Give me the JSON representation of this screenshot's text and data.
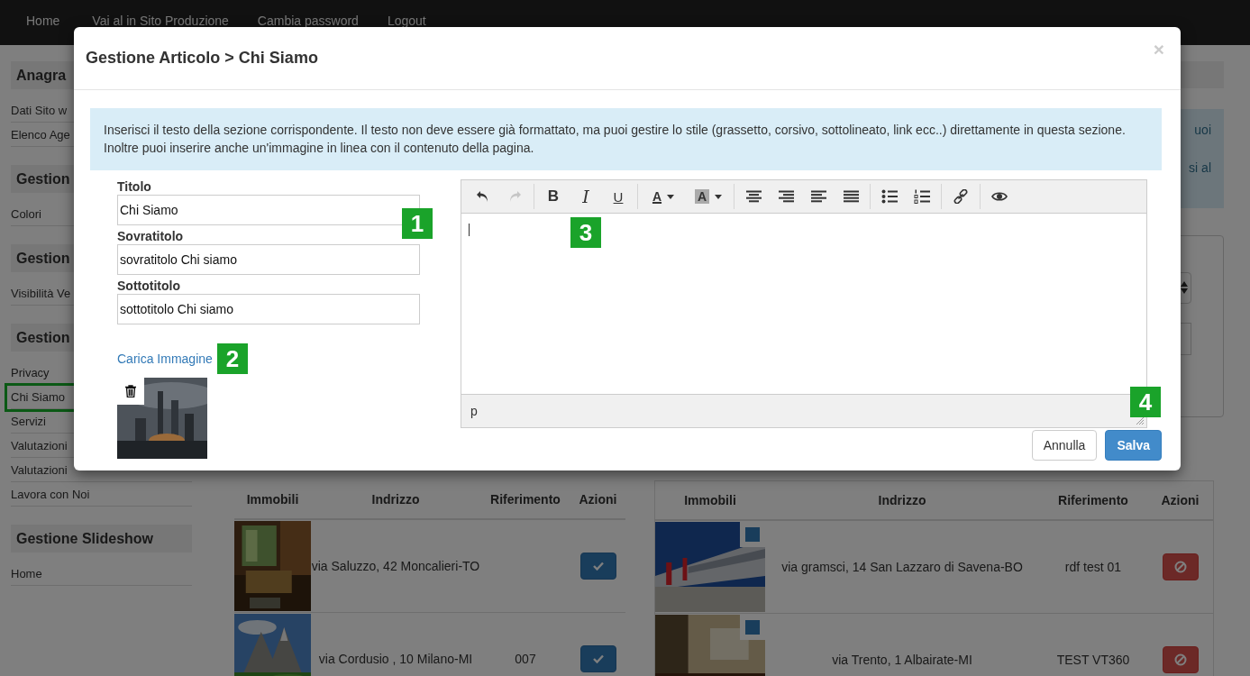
{
  "top_nav": {
    "links": [
      "Home",
      "Vai al in Sito Produzione",
      "Cambia password",
      "Logout"
    ]
  },
  "sidebar": {
    "sections": [
      {
        "heading": "Anagra",
        "items": [
          {
            "label": "Dati Sito w",
            "highlighted": false
          },
          {
            "label": "Elenco Age",
            "highlighted": false
          }
        ]
      },
      {
        "heading": "Gestion",
        "items": [
          {
            "label": "Colori",
            "highlighted": false
          }
        ]
      },
      {
        "heading": "Gestion",
        "items": [
          {
            "label": "Visibilità Ve",
            "highlighted": false
          }
        ]
      },
      {
        "heading": "Gestion",
        "items": [
          {
            "label": "Privacy",
            "highlighted": false
          },
          {
            "label": "Chi Siamo",
            "highlighted": true
          },
          {
            "label": "Servizi",
            "highlighted": false
          },
          {
            "label": "Valutazioni",
            "highlighted": false
          },
          {
            "label": "Valutazioni",
            "highlighted": false
          },
          {
            "label": "Lavora con Noi",
            "highlighted": false
          }
        ]
      },
      {
        "heading": "Gestione Slideshow",
        "items": [
          {
            "label": "Home",
            "highlighted": false
          }
        ]
      }
    ]
  },
  "main": {
    "info_fragments": [
      "uoi",
      "si al"
    ]
  },
  "tables": [
    {
      "bordered": false,
      "photo_checkbox": false,
      "columns": [
        "Immobili",
        "Indrizzo",
        "Riferimento",
        "Azioni"
      ],
      "rows": [
        {
          "address": "via Saluzzo, 42 Moncalieri-TO",
          "reference": "",
          "kind": "confirm"
        },
        {
          "address": "via Cordusio , 10 Milano-MI",
          "reference": "007",
          "kind": "confirm"
        }
      ]
    },
    {
      "bordered": true,
      "photo_checkbox": true,
      "columns": [
        "Immobili",
        "Indrizzo",
        "Riferimento",
        "Azioni"
      ],
      "rows": [
        {
          "address": "via gramsci, 14 San Lazzaro di Savena-BO",
          "reference": "rdf test 01",
          "kind": "block"
        },
        {
          "address": "via Trento, 1 Albairate-MI",
          "reference": "TEST VT360",
          "kind": "block"
        }
      ]
    }
  ],
  "modal": {
    "title": "Gestione Articolo > Chi Siamo",
    "close": "×",
    "info": "Inserisci il testo della sezione corrispondente. Il testo non deve essere già formattato, ma puoi gestire lo stile (grassetto, corsivo, sottolineato, link ecc..) direttamente in questa sezione. Inoltre puoi inserire anche un'immagine in linea con il contenuto della pagina.",
    "fields": [
      {
        "label": "Titolo",
        "value": "Chi Siamo",
        "badge": "1"
      },
      {
        "label": "Sovratitolo",
        "value": "sovratitolo Chi siamo"
      },
      {
        "label": "Sottotitolo",
        "value": "sottotitolo Chi siamo"
      }
    ],
    "upload_link": "Carica Immagine",
    "upload_badge": "2",
    "editor": {
      "toolbar": [
        [
          {
            "kind": "undo",
            "disabled": false
          },
          {
            "kind": "redo",
            "disabled": true
          }
        ],
        [
          {
            "kind": "bold",
            "label": "B",
            "disabled": false
          },
          {
            "kind": "italic",
            "label": "I",
            "disabled": false
          },
          {
            "kind": "underline",
            "label": "U",
            "disabled": false
          }
        ],
        [
          {
            "kind": "forecolor",
            "label": "A",
            "disabled": false
          },
          {
            "kind": "backcolor",
            "label": "A",
            "disabled": false
          }
        ],
        [
          {
            "kind": "align-center",
            "disabled": false
          },
          {
            "kind": "align-right",
            "disabled": false
          },
          {
            "kind": "align-left",
            "disabled": false
          },
          {
            "kind": "justify",
            "disabled": false
          }
        ],
        [
          {
            "kind": "bullets",
            "disabled": false
          },
          {
            "kind": "numbers",
            "disabled": false
          }
        ],
        [
          {
            "kind": "link",
            "disabled": false
          }
        ],
        [
          {
            "kind": "preview",
            "disabled": false
          }
        ]
      ],
      "content_badge": "3",
      "status": "p",
      "status_badge": "4"
    },
    "buttons": [
      {
        "label": "Annulla",
        "kind": "default"
      },
      {
        "label": "Salva",
        "kind": "primary"
      }
    ]
  }
}
